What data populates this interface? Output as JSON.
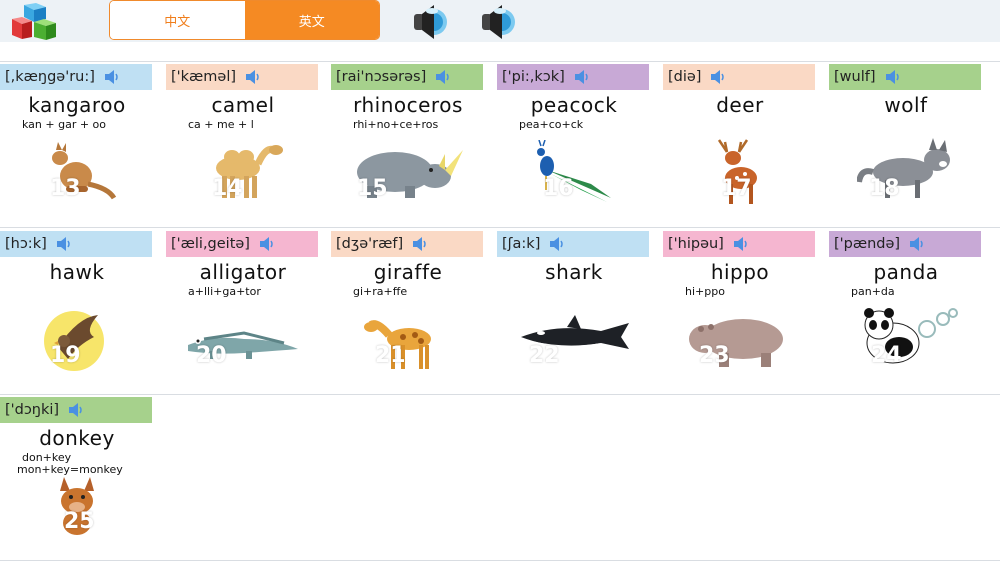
{
  "header": {
    "tab_chinese": "中文",
    "tab_english": "英文",
    "active_tab": "英文"
  },
  "colors": {
    "blue": "#bfe0f3",
    "peach": "#fad9c5",
    "green": "#a6d18c",
    "purple": "#c8a9d6",
    "pink": "#f5b6d0",
    "orange": "#f58a23"
  },
  "animals": [
    {
      "phonetic": "[,kæŋgə'ru:]",
      "word": "kangaroo",
      "syllables": [
        "kan + gar + oo"
      ],
      "number": "13",
      "color": "blue",
      "icon": "kangaroo-icon"
    },
    {
      "phonetic": "['kæməl]",
      "word": "camel",
      "syllables": [
        "ca + me + l"
      ],
      "number": "14",
      "color": "peach",
      "icon": "camel-icon"
    },
    {
      "phonetic": "[rai'nɔsərəs]",
      "word": "rhinoceros",
      "syllables": [
        "rhi+no+ce+ros"
      ],
      "number": "15",
      "color": "green",
      "icon": "rhino-icon"
    },
    {
      "phonetic": "['pi:,kɔk]",
      "word": "peacock",
      "syllables": [
        "pea+co+ck"
      ],
      "number": "16",
      "color": "purple",
      "icon": "peacock-icon"
    },
    {
      "phonetic": "[diə]",
      "word": "deer",
      "syllables": [],
      "number": "17",
      "color": "peach",
      "icon": "deer-icon"
    },
    {
      "phonetic": "[wulf]",
      "word": "wolf",
      "syllables": [],
      "number": "18",
      "color": "green",
      "icon": "wolf-icon"
    },
    {
      "phonetic": "[hɔ:k]",
      "word": "hawk",
      "syllables": [],
      "number": "19",
      "color": "blue",
      "icon": "hawk-icon"
    },
    {
      "phonetic": "['æli,geitə]",
      "word": "alligator",
      "syllables": [
        "a+lli+ga+tor"
      ],
      "number": "20",
      "color": "pink",
      "icon": "alligator-icon"
    },
    {
      "phonetic": "[dʒə'ræf]",
      "word": "giraffe",
      "syllables": [
        "gi+ra+ffe"
      ],
      "number": "21",
      "color": "peach",
      "icon": "giraffe-icon"
    },
    {
      "phonetic": "[ʃa:k]",
      "word": "shark",
      "syllables": [],
      "number": "22",
      "color": "blue",
      "icon": "shark-icon"
    },
    {
      "phonetic": "['hipəu]",
      "word": "hippo",
      "syllables": [
        "hi+ppo"
      ],
      "number": "23",
      "color": "pink",
      "icon": "hippo-icon"
    },
    {
      "phonetic": "['pændə]",
      "word": "panda",
      "syllables": [
        "pan+da"
      ],
      "number": "24",
      "color": "purple",
      "icon": "panda-icon"
    },
    {
      "phonetic": "['dɔŋki]",
      "word": "donkey",
      "syllables": [
        "don+key",
        "mon+key=monkey"
      ],
      "number": "25",
      "color": "green",
      "icon": "donkey-icon"
    }
  ]
}
